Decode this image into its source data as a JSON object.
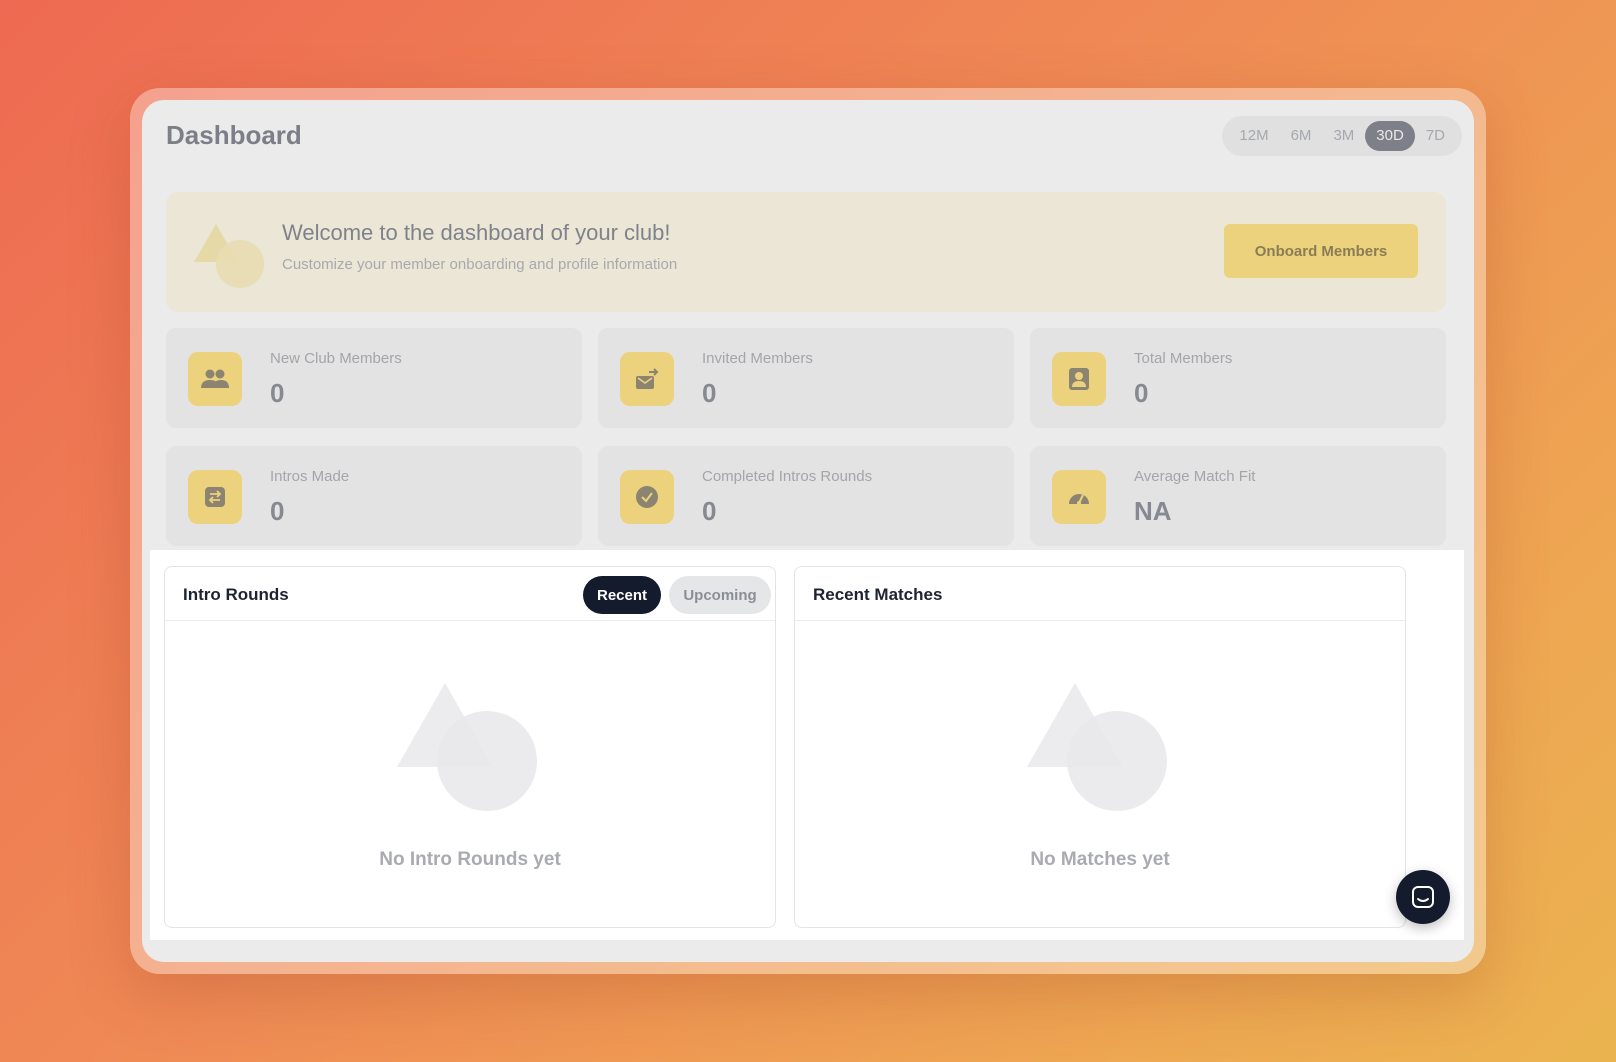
{
  "header": {
    "title": "Dashboard",
    "ranges": [
      "12M",
      "6M",
      "3M",
      "30D",
      "7D"
    ],
    "active_range": "30D"
  },
  "welcome": {
    "title": "Welcome to the dashboard of your club!",
    "subtitle": "Customize your member onboarding and profile information",
    "button_label": "Onboard Members"
  },
  "stats": [
    {
      "label": "New Club Members",
      "value": "0",
      "icon": "users-icon"
    },
    {
      "label": "Invited Members",
      "value": "0",
      "icon": "invite-mail-icon"
    },
    {
      "label": "Total Members",
      "value": "0",
      "icon": "member-badge-icon"
    },
    {
      "label": "Intros Made",
      "value": "0",
      "icon": "swap-icon"
    },
    {
      "label": "Completed Intros Rounds",
      "value": "0",
      "icon": "check-circle-icon"
    },
    {
      "label": "Average Match Fit",
      "value": "NA",
      "icon": "gauge-icon"
    }
  ],
  "intro_rounds": {
    "title": "Intro Rounds",
    "tab_recent": "Recent",
    "tab_upcoming": "Upcoming",
    "active_tab": "Recent",
    "empty_text": "No Intro Rounds yet"
  },
  "recent_matches": {
    "title": "Recent Matches",
    "empty_text": "No Matches yet"
  },
  "colors": {
    "accent_yellow": "#ecd27c",
    "dark_navy": "#141b2d",
    "background_gradient_start": "#ee6a52",
    "background_gradient_end": "#ebb350"
  }
}
